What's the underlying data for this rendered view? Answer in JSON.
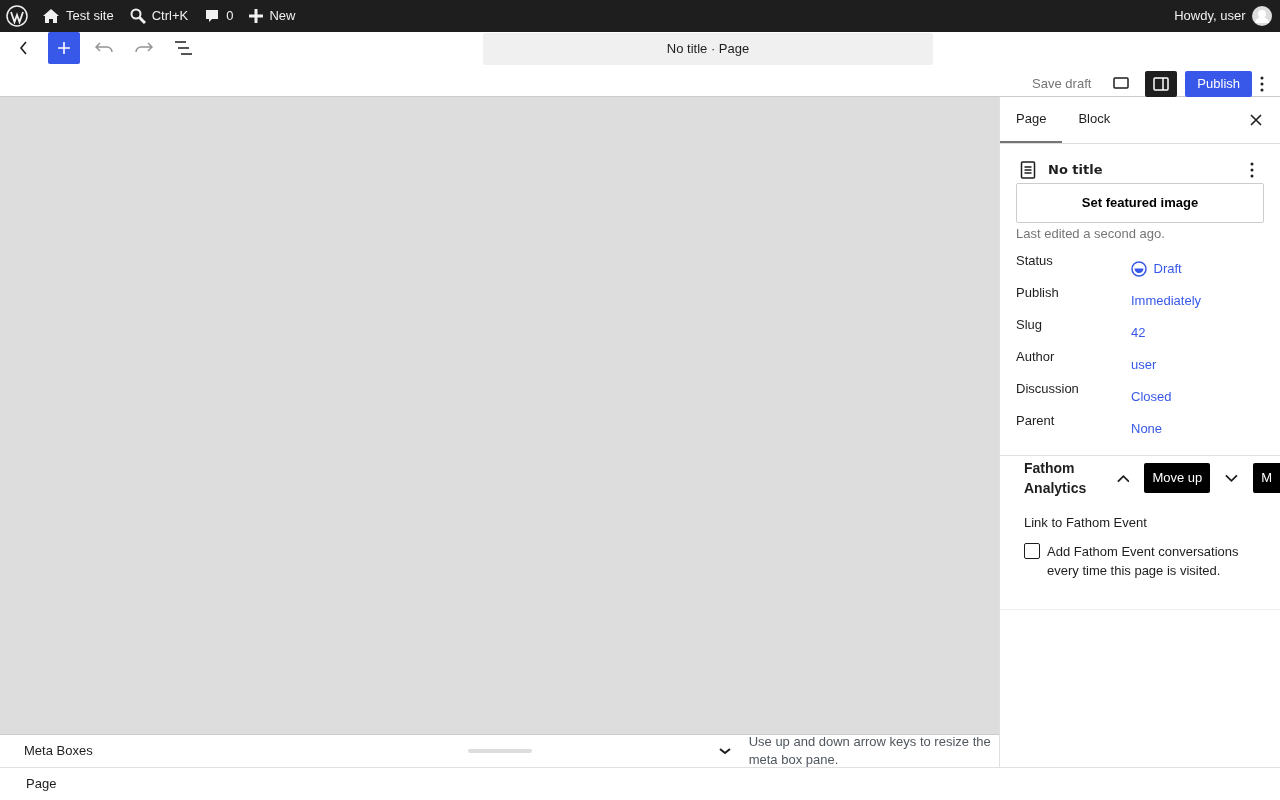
{
  "admin_bar": {
    "site": "Test site",
    "search_shortcut": "Ctrl+K",
    "comments": "0",
    "new": "New",
    "greeting": "Howdy, user"
  },
  "header": {
    "document_title": "No title · Page",
    "save_draft": "Save draft",
    "publish": "Publish"
  },
  "sidebar": {
    "tabs": [
      {
        "label": "Page",
        "selected": true
      },
      {
        "label": "Block",
        "selected": false
      }
    ],
    "title": "No title",
    "featured_image_button": "Set featured image",
    "last_edited": "Last edited a second ago.",
    "fields": [
      {
        "label": "Status",
        "value": "Draft",
        "kind": "status"
      },
      {
        "label": "Publish",
        "value": "Immediately",
        "kind": "link"
      },
      {
        "label": "Slug",
        "value": "42",
        "kind": "link"
      },
      {
        "label": "Author",
        "value": "user",
        "kind": "link"
      },
      {
        "label": "Discussion",
        "value": "Closed",
        "kind": "link"
      },
      {
        "label": "Parent",
        "value": "None",
        "kind": "link"
      }
    ]
  },
  "meta_box": {
    "title": "Fathom Analytics",
    "tooltips": [
      "Move up",
      "M"
    ],
    "field_label": "Link to Fathom Event",
    "checkbox": {
      "label": "Add Fathom Event conversations every time this page is visited.",
      "checked": false
    }
  },
  "meta_boxes_bar": {
    "title": "Meta Boxes",
    "hint": "Use up and down arrow keys to resize the meta box pane."
  },
  "footer": {
    "breadcrumb": "Page"
  }
}
